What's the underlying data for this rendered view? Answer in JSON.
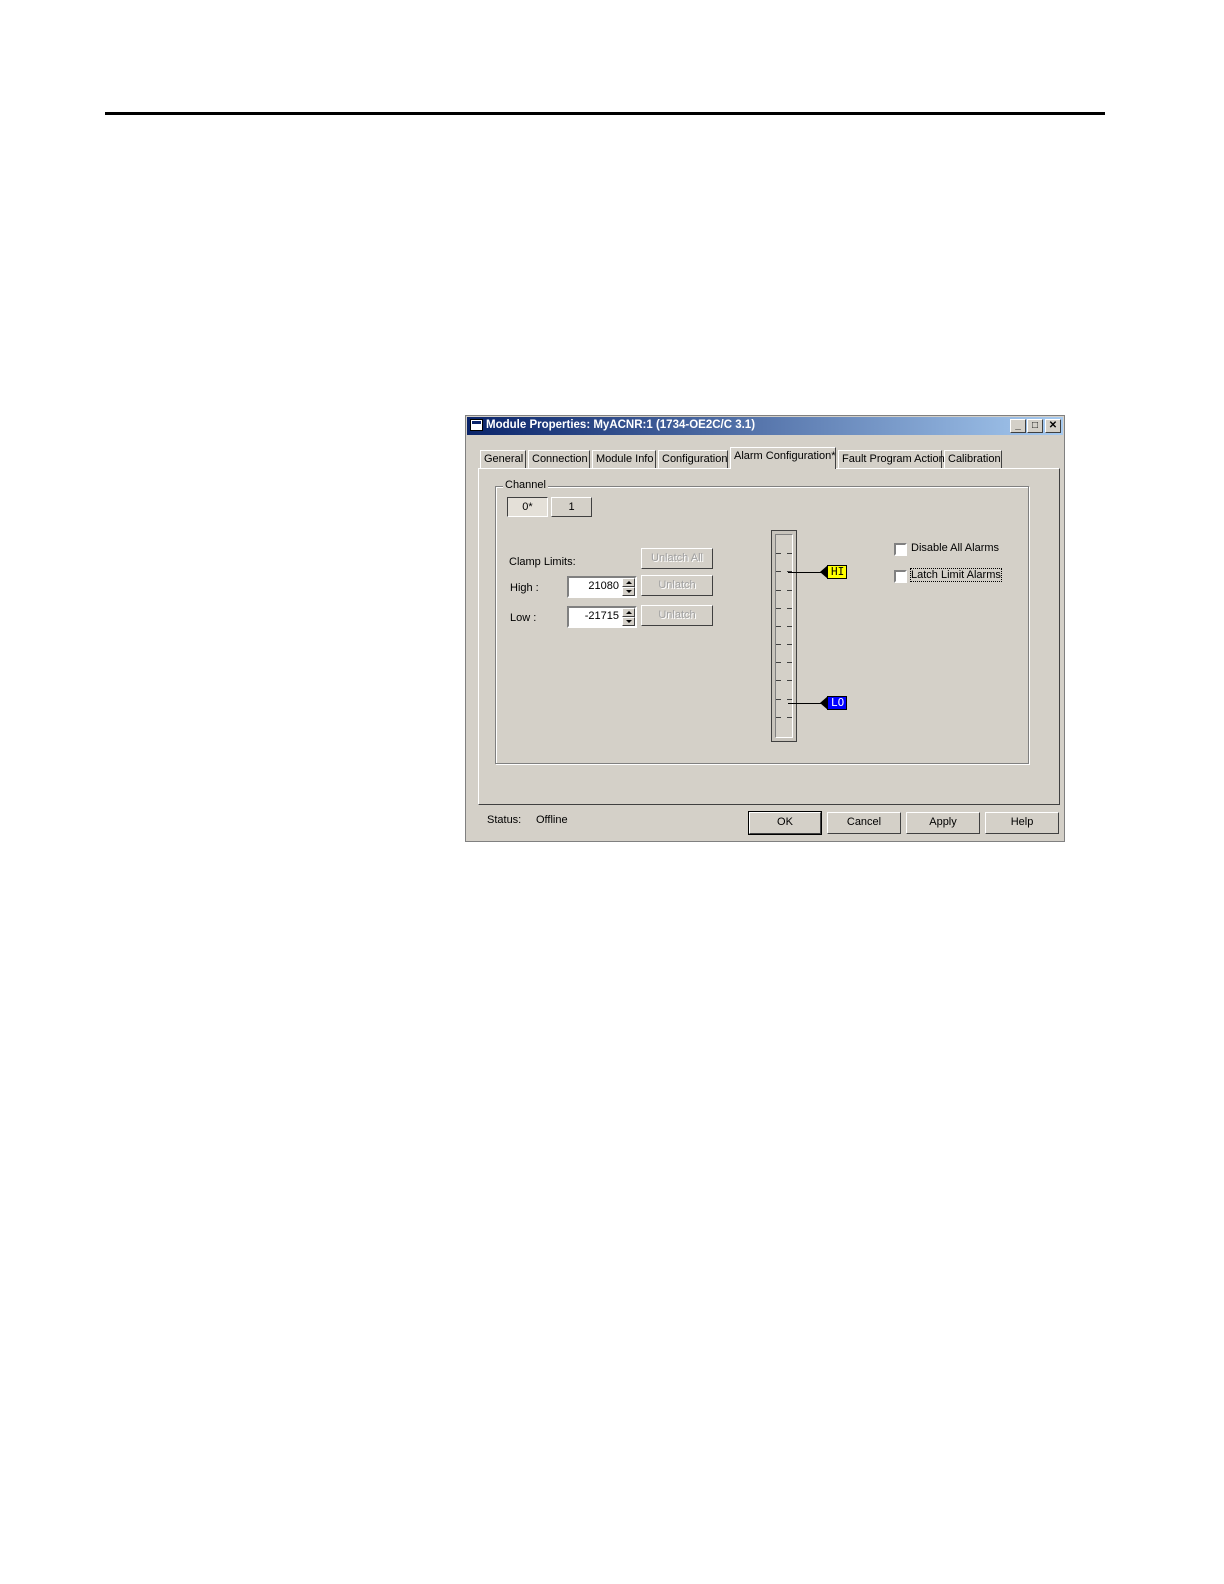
{
  "window": {
    "title": "Module Properties: MyACNR:1 (1734-OE2C/C 3.1)",
    "controls": {
      "minimize": "_",
      "maximize": "□",
      "close": "✕"
    }
  },
  "tabs": [
    {
      "label": "General"
    },
    {
      "label": "Connection"
    },
    {
      "label": "Module Info"
    },
    {
      "label": "Configuration"
    },
    {
      "label": "Alarm Configuration*",
      "active": true
    },
    {
      "label": "Fault Program Action"
    },
    {
      "label": "Calibration"
    }
  ],
  "channel": {
    "group_label": "Channel",
    "buttons": [
      {
        "label": "0*",
        "selected": true
      },
      {
        "label": "1"
      }
    ]
  },
  "clamp": {
    "title": "Clamp Limits:",
    "unlatch_all": "Unlatch All",
    "high_label": "High :",
    "high_value": "21080",
    "low_label": "Low :",
    "low_value": "-21715",
    "unlatch": "Unlatch"
  },
  "scale": {
    "hi_marker": "HI",
    "lo_marker": "LO",
    "hi_color": "#ffff00",
    "lo_color": "#0000ff"
  },
  "options": {
    "disable_all_alarms": "Disable All Alarms",
    "latch_limit_alarms": "Latch Limit Alarms"
  },
  "status": {
    "label": "Status:",
    "value": "Offline"
  },
  "footer_buttons": {
    "ok": "OK",
    "cancel": "Cancel",
    "apply": "Apply",
    "help": "Help"
  }
}
